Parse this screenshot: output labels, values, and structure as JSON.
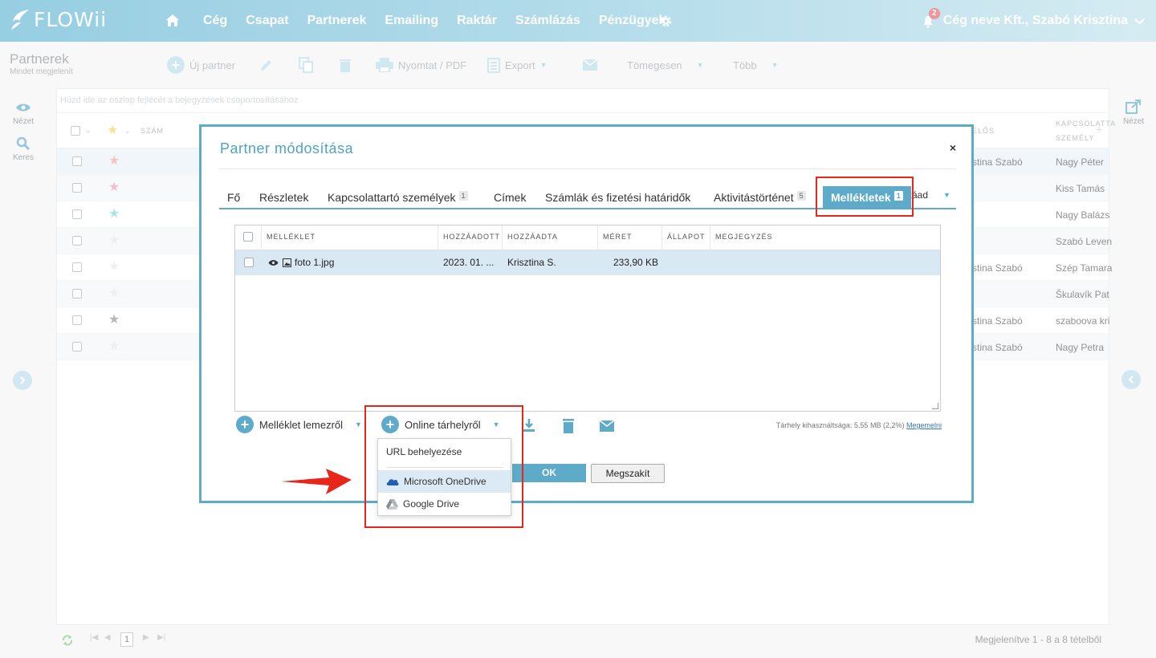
{
  "app": {
    "logo": "FLOWii"
  },
  "nav": {
    "items": [
      "Cég",
      "Csapat",
      "Partnerek",
      "Emailing",
      "Raktár",
      "Számlázás",
      "Pénzügyek"
    ]
  },
  "user": {
    "name": "Cég neve Kft., Szabó Krisztina",
    "notifications": "2"
  },
  "page": {
    "title": "Partnerek",
    "subtitle": "Mindet megjelenít"
  },
  "toolbar": {
    "new_partner": "Új partner",
    "print": "Nyomtat / PDF",
    "export": "Export",
    "bulk": "Tömegesen",
    "more": "Több"
  },
  "left_rail": {
    "view": "Nézet",
    "search": "Keres"
  },
  "right_rail": {
    "view": "Nézet"
  },
  "grid": {
    "group_hint": "Húzd ide az oszlop fejlécét a bejegyzések csoportosításához",
    "col_number": "SZÁM",
    "col_owner_partial": "ELŐS",
    "col_contact": "KAPCSOLATTA",
    "col_contact_2": "SZEMÉLY",
    "rows": [
      {
        "star_color": "#f3a39a",
        "owner": "zstina Szabó",
        "contact": "Nagy Péter"
      },
      {
        "star_color": "#e89bc0",
        "owner": "",
        "contact": "Kiss Tamás"
      },
      {
        "star_color": "#7fd6cf",
        "owner": "",
        "contact": "Nagy Balázs"
      },
      {
        "star_color": "#e4e6e8",
        "owner": "",
        "contact": "Szabó Leven"
      },
      {
        "star_color": "#e4e6e8",
        "owner": "zstina Szabó",
        "contact": "Szép Tamara"
      },
      {
        "star_color": "#e4e6e8",
        "owner": "",
        "contact": "Škulavík Pat"
      },
      {
        "star_color": "#8f9398",
        "owner": "zstina Szabó",
        "contact": "szaboova kri"
      },
      {
        "star_color": "#e4e6e8",
        "owner": "zstina Szabó",
        "contact": "Nagy Petra"
      }
    ]
  },
  "footer": {
    "page": "1",
    "summary": "Megjelenítve 1 - 8 a 8 tételből"
  },
  "modal": {
    "title": "Partner módosítása",
    "close": "×",
    "tabs": [
      {
        "label": "Fő",
        "badge": ""
      },
      {
        "label": "Részletek",
        "badge": ""
      },
      {
        "label": "Kapcsolattartó személyek",
        "badge": "1"
      },
      {
        "label": "Címek",
        "badge": ""
      },
      {
        "label": "Számlák és fizetési határidők",
        "badge": ""
      },
      {
        "label": "Aktivitástörténet",
        "badge": "5"
      },
      {
        "label": "Mellékletek",
        "badge": "1"
      }
    ],
    "tab_overflow": "záad",
    "attachments": {
      "headers": [
        "MELLÉKLET",
        "HOZZÁADOTT",
        "HOZZÁADTA",
        "MÉRET",
        "ÁLLAPOT",
        "MEGJEGYZÉS"
      ],
      "rows": [
        {
          "name": "foto 1.jpg",
          "added": "2023. 01. ...",
          "added_by": "Krisztina S.",
          "size": "233,90 KB",
          "status": "",
          "note": ""
        }
      ]
    },
    "actions": {
      "from_disk": "Melléklet lemezről",
      "online": "Online tárhelyről"
    },
    "storage": {
      "text": "Tárhely kihasználtsága: 5,55 MB (2,2%)",
      "link": "Megemelni"
    },
    "ok": "OK",
    "cancel": "Megszakít"
  },
  "dropdown": {
    "items": [
      "URL behelyezése",
      "Microsoft OneDrive",
      "Google Drive"
    ],
    "highlighted": "Microsoft OneDrive"
  },
  "colors": {
    "accent": "#5dabc8",
    "highlight_red": "#e8271a"
  }
}
